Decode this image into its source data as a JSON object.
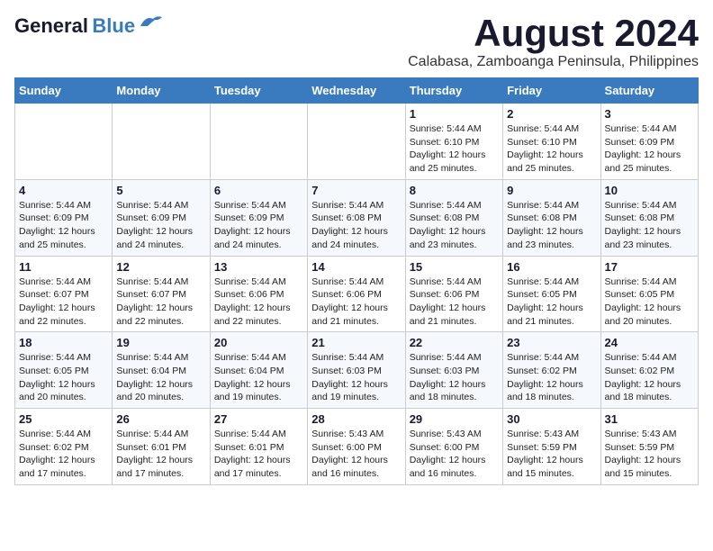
{
  "logo": {
    "general": "General",
    "blue": "Blue"
  },
  "header": {
    "month": "August 2024",
    "location": "Calabasa, Zamboanga Peninsula, Philippines"
  },
  "days_of_week": [
    "Sunday",
    "Monday",
    "Tuesday",
    "Wednesday",
    "Thursday",
    "Friday",
    "Saturday"
  ],
  "weeks": [
    [
      {
        "day": "",
        "info": ""
      },
      {
        "day": "",
        "info": ""
      },
      {
        "day": "",
        "info": ""
      },
      {
        "day": "",
        "info": ""
      },
      {
        "day": "1",
        "info": "Sunrise: 5:44 AM\nSunset: 6:10 PM\nDaylight: 12 hours\nand 25 minutes."
      },
      {
        "day": "2",
        "info": "Sunrise: 5:44 AM\nSunset: 6:10 PM\nDaylight: 12 hours\nand 25 minutes."
      },
      {
        "day": "3",
        "info": "Sunrise: 5:44 AM\nSunset: 6:09 PM\nDaylight: 12 hours\nand 25 minutes."
      }
    ],
    [
      {
        "day": "4",
        "info": "Sunrise: 5:44 AM\nSunset: 6:09 PM\nDaylight: 12 hours\nand 25 minutes."
      },
      {
        "day": "5",
        "info": "Sunrise: 5:44 AM\nSunset: 6:09 PM\nDaylight: 12 hours\nand 24 minutes."
      },
      {
        "day": "6",
        "info": "Sunrise: 5:44 AM\nSunset: 6:09 PM\nDaylight: 12 hours\nand 24 minutes."
      },
      {
        "day": "7",
        "info": "Sunrise: 5:44 AM\nSunset: 6:08 PM\nDaylight: 12 hours\nand 24 minutes."
      },
      {
        "day": "8",
        "info": "Sunrise: 5:44 AM\nSunset: 6:08 PM\nDaylight: 12 hours\nand 23 minutes."
      },
      {
        "day": "9",
        "info": "Sunrise: 5:44 AM\nSunset: 6:08 PM\nDaylight: 12 hours\nand 23 minutes."
      },
      {
        "day": "10",
        "info": "Sunrise: 5:44 AM\nSunset: 6:08 PM\nDaylight: 12 hours\nand 23 minutes."
      }
    ],
    [
      {
        "day": "11",
        "info": "Sunrise: 5:44 AM\nSunset: 6:07 PM\nDaylight: 12 hours\nand 22 minutes."
      },
      {
        "day": "12",
        "info": "Sunrise: 5:44 AM\nSunset: 6:07 PM\nDaylight: 12 hours\nand 22 minutes."
      },
      {
        "day": "13",
        "info": "Sunrise: 5:44 AM\nSunset: 6:06 PM\nDaylight: 12 hours\nand 22 minutes."
      },
      {
        "day": "14",
        "info": "Sunrise: 5:44 AM\nSunset: 6:06 PM\nDaylight: 12 hours\nand 21 minutes."
      },
      {
        "day": "15",
        "info": "Sunrise: 5:44 AM\nSunset: 6:06 PM\nDaylight: 12 hours\nand 21 minutes."
      },
      {
        "day": "16",
        "info": "Sunrise: 5:44 AM\nSunset: 6:05 PM\nDaylight: 12 hours\nand 21 minutes."
      },
      {
        "day": "17",
        "info": "Sunrise: 5:44 AM\nSunset: 6:05 PM\nDaylight: 12 hours\nand 20 minutes."
      }
    ],
    [
      {
        "day": "18",
        "info": "Sunrise: 5:44 AM\nSunset: 6:05 PM\nDaylight: 12 hours\nand 20 minutes."
      },
      {
        "day": "19",
        "info": "Sunrise: 5:44 AM\nSunset: 6:04 PM\nDaylight: 12 hours\nand 20 minutes."
      },
      {
        "day": "20",
        "info": "Sunrise: 5:44 AM\nSunset: 6:04 PM\nDaylight: 12 hours\nand 19 minutes."
      },
      {
        "day": "21",
        "info": "Sunrise: 5:44 AM\nSunset: 6:03 PM\nDaylight: 12 hours\nand 19 minutes."
      },
      {
        "day": "22",
        "info": "Sunrise: 5:44 AM\nSunset: 6:03 PM\nDaylight: 12 hours\nand 18 minutes."
      },
      {
        "day": "23",
        "info": "Sunrise: 5:44 AM\nSunset: 6:02 PM\nDaylight: 12 hours\nand 18 minutes."
      },
      {
        "day": "24",
        "info": "Sunrise: 5:44 AM\nSunset: 6:02 PM\nDaylight: 12 hours\nand 18 minutes."
      }
    ],
    [
      {
        "day": "25",
        "info": "Sunrise: 5:44 AM\nSunset: 6:02 PM\nDaylight: 12 hours\nand 17 minutes."
      },
      {
        "day": "26",
        "info": "Sunrise: 5:44 AM\nSunset: 6:01 PM\nDaylight: 12 hours\nand 17 minutes."
      },
      {
        "day": "27",
        "info": "Sunrise: 5:44 AM\nSunset: 6:01 PM\nDaylight: 12 hours\nand 17 minutes."
      },
      {
        "day": "28",
        "info": "Sunrise: 5:43 AM\nSunset: 6:00 PM\nDaylight: 12 hours\nand 16 minutes."
      },
      {
        "day": "29",
        "info": "Sunrise: 5:43 AM\nSunset: 6:00 PM\nDaylight: 12 hours\nand 16 minutes."
      },
      {
        "day": "30",
        "info": "Sunrise: 5:43 AM\nSunset: 5:59 PM\nDaylight: 12 hours\nand 15 minutes."
      },
      {
        "day": "31",
        "info": "Sunrise: 5:43 AM\nSunset: 5:59 PM\nDaylight: 12 hours\nand 15 minutes."
      }
    ]
  ]
}
